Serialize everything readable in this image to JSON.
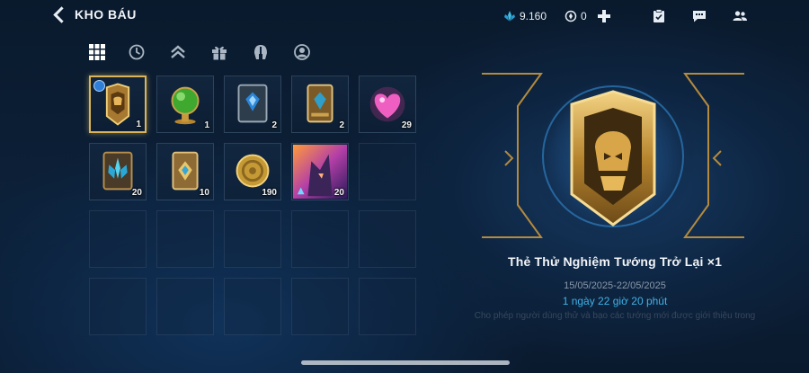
{
  "header": {
    "title": "KHO BÁU",
    "crystal_amount": "9.160",
    "token_amount": "0"
  },
  "tabs": [
    {
      "icon": "grid-icon"
    },
    {
      "icon": "clock-icon"
    },
    {
      "icon": "rank-chevrons-icon"
    },
    {
      "icon": "gift-icon"
    },
    {
      "icon": "helmet-icon"
    },
    {
      "icon": "avatar-icon"
    }
  ],
  "inventory": [
    {
      "item": "return-trial-card",
      "count": "1",
      "selected": true,
      "timed": true
    },
    {
      "item": "green-orb",
      "count": "1"
    },
    {
      "item": "blue-rune-card",
      "count": "2"
    },
    {
      "item": "gold-rune-card",
      "count": "2"
    },
    {
      "item": "pink-heart",
      "count": "29"
    },
    {
      "item": "crystal-card",
      "count": "20"
    },
    {
      "item": "diamond-card",
      "count": "10"
    },
    {
      "item": "gold-coin",
      "count": "190"
    },
    {
      "item": "hero-skin",
      "count": "20"
    }
  ],
  "detail": {
    "name": "Thẻ Thử Nghiệm Tướng Trở Lại ×1",
    "date_range": "15/05/2025-22/05/2025",
    "remaining": "1 ngày 22 giờ 20 phút",
    "description": "Cho phép người dùng thử và bạo các tướng mới được giới thiệu trong"
  },
  "colors": {
    "accent_gold": "#d9b45a",
    "time_blue": "#3fb2e6",
    "bg_dark": "#0a1a2d"
  }
}
